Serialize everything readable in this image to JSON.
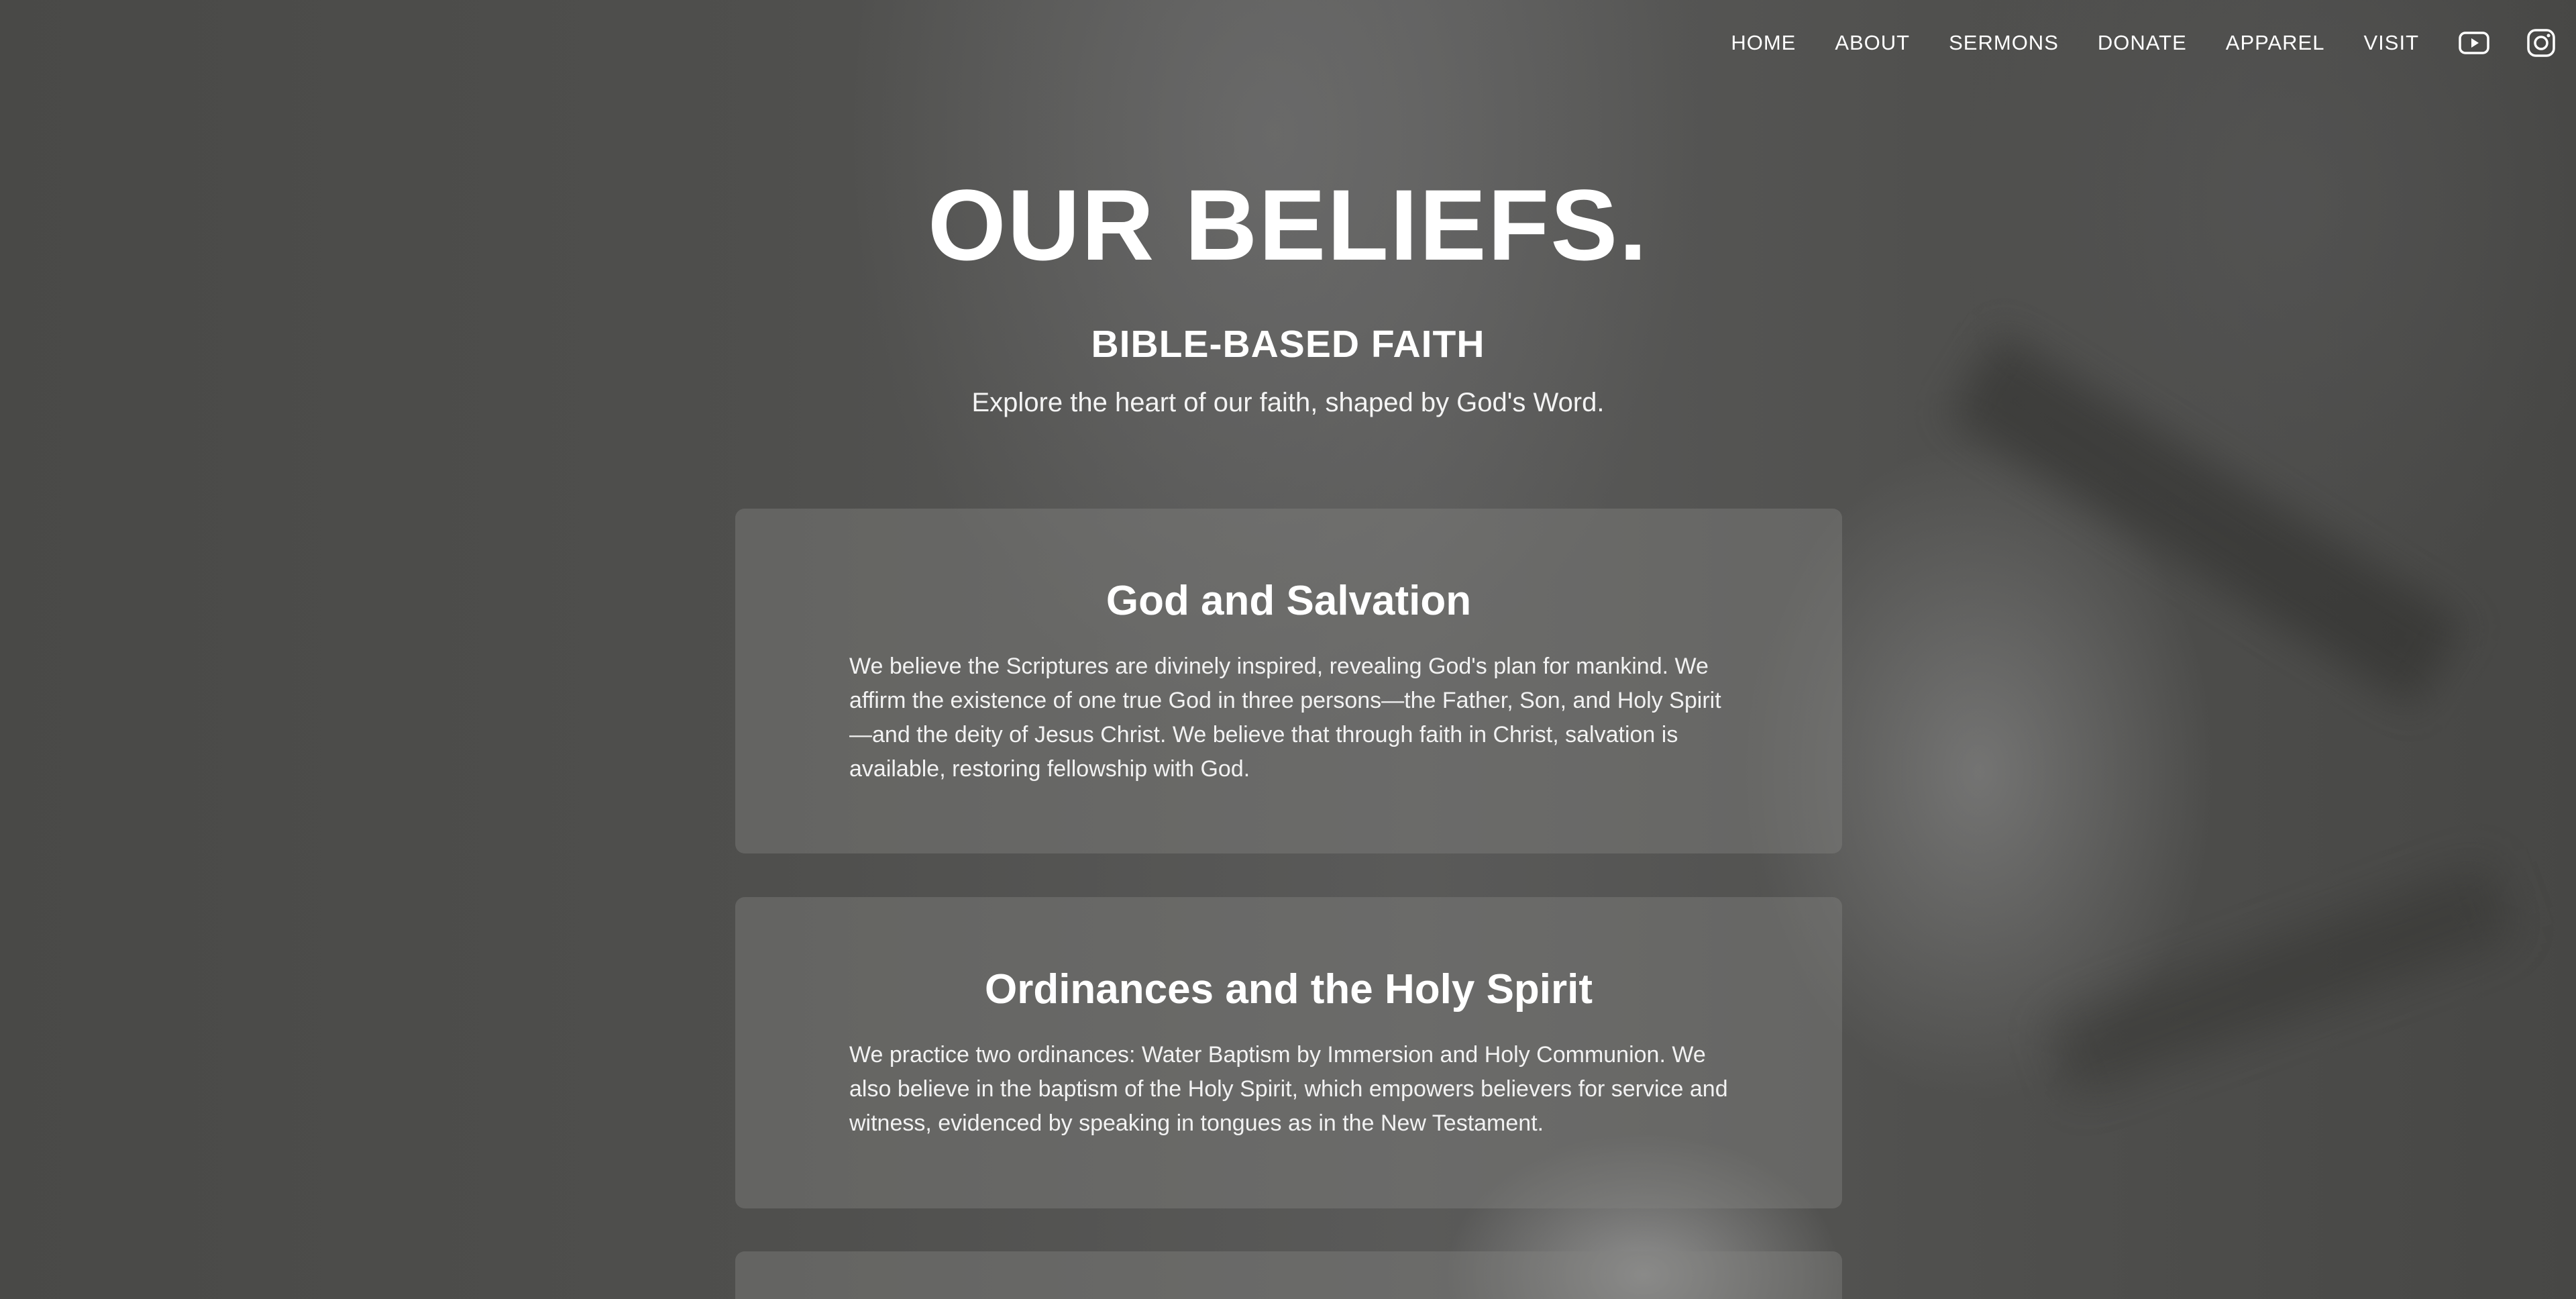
{
  "nav": {
    "items": [
      {
        "label": "HOME",
        "name": "nav-home"
      },
      {
        "label": "ABOUT",
        "name": "nav-about"
      },
      {
        "label": "SERMONS",
        "name": "nav-sermons"
      },
      {
        "label": "DONATE",
        "name": "nav-donate"
      },
      {
        "label": "APPAREL",
        "name": "nav-apparel"
      },
      {
        "label": "VISIT",
        "name": "nav-visit"
      }
    ],
    "icons": [
      "youtube-icon",
      "instagram-icon"
    ]
  },
  "hero": {
    "title": "OUR BELIEFS.",
    "subtitle": "BIBLE-BASED FAITH",
    "description": "Explore the heart of our faith, shaped by God's Word."
  },
  "cards": [
    {
      "title": "God and Salvation",
      "body": "We believe the Scriptures are divinely inspired, revealing God's plan for mankind. We affirm the existence of one true God in three persons—the Father, Son, and Holy Spirit—and the deity of Jesus Christ. We believe that through faith in Christ, salvation is available, restoring fellowship with God."
    },
    {
      "title": "Ordinances and the Holy Spirit",
      "body": "We practice two ordinances: Water Baptism by Immersion and Holy Communion. We also believe in the baptism of the Holy Spirit, which empowers believers for service and witness, evidenced by speaking in tongues as in the New Testament."
    }
  ],
  "colors": {
    "text": "#ffffff",
    "card_bg": "rgba(130,130,128,0.42)"
  }
}
